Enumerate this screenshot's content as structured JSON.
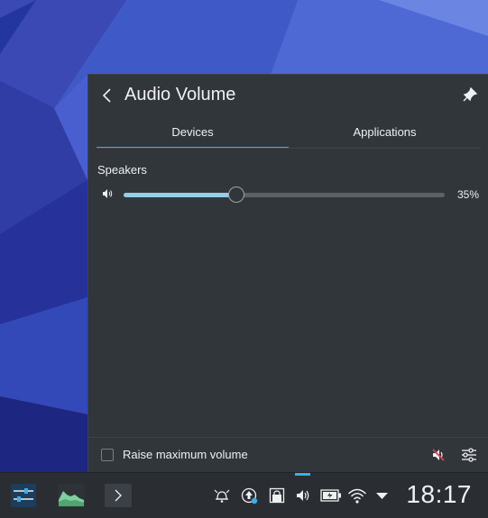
{
  "popup": {
    "title": "Audio Volume",
    "tabs": [
      {
        "label": "Devices",
        "active": true
      },
      {
        "label": "Applications",
        "active": false
      }
    ],
    "device": {
      "name": "Speakers",
      "volume_percent": 35,
      "volume_text": "35%"
    },
    "footer": {
      "raise_max_label": "Raise maximum volume",
      "raise_max_checked": false
    }
  },
  "taskbar": {
    "clock": "18:17",
    "tray_icons": [
      "alarm-icon",
      "updates-icon",
      "vault-icon",
      "volume-icon",
      "battery-icon",
      "wifi-icon",
      "expand-tray-icon"
    ],
    "launchers": [
      "system-settings-icon",
      "system-monitor-icon",
      "terminal-icon"
    ]
  },
  "colors": {
    "accent": "#3daee9",
    "panel_bg": "#31363b",
    "slider_fill": "#93cee9",
    "taskbar_bg": "#2a2e32"
  }
}
